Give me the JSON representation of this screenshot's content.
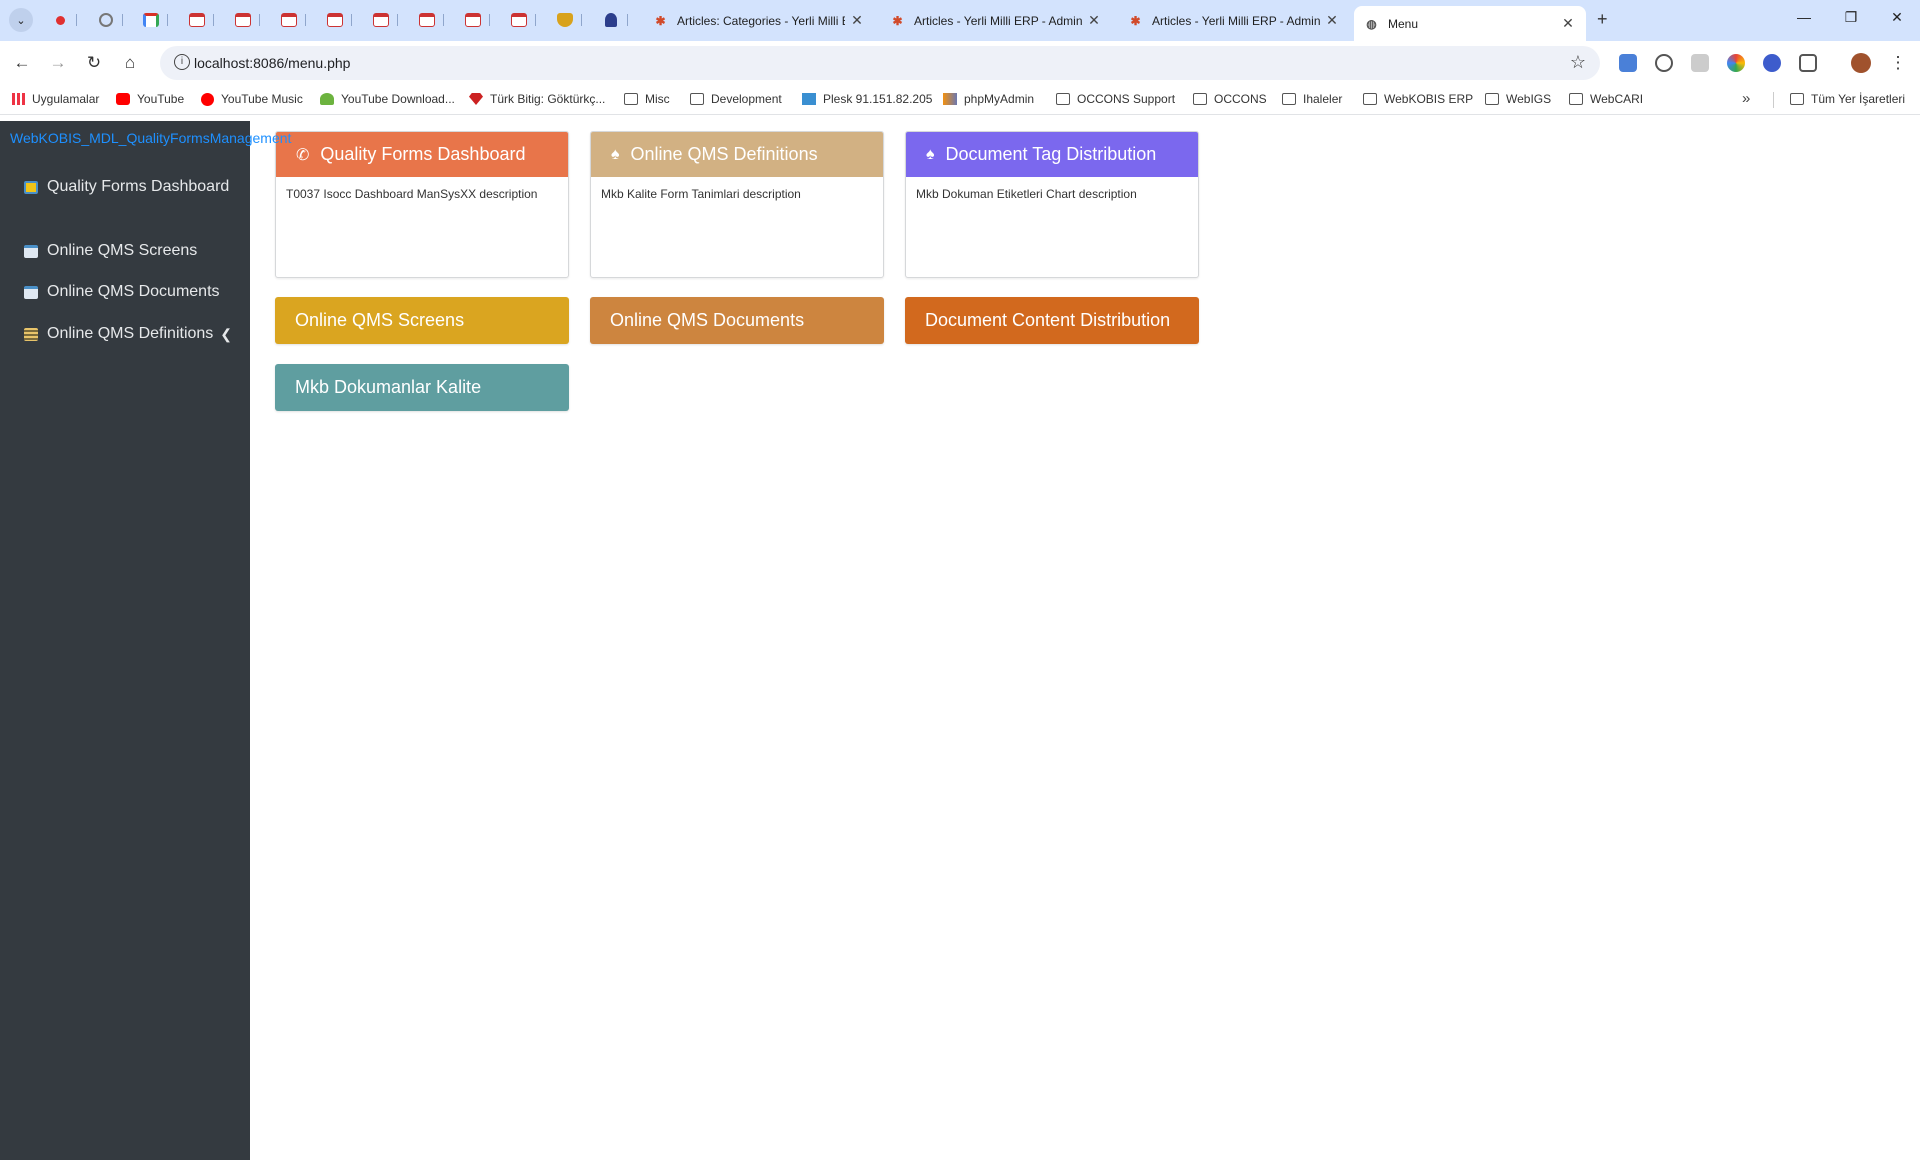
{
  "browser": {
    "tabs": [
      {
        "title": "Articles: Categories - Yerli Milli ERP - Administration"
      },
      {
        "title": "Articles - Yerli Milli ERP - Administration"
      },
      {
        "title": "Articles - Yerli Milli ERP - Administration"
      },
      {
        "title": "Menu",
        "active": true
      }
    ],
    "url": "localhost:8086/menu.php",
    "bookmarks": [
      "Uygulamalar",
      "YouTube",
      "YouTube Music",
      "YouTube Download...",
      "Türk Bitig: Göktürkç...",
      "Misc",
      "Development",
      "Plesk 91.151.82.205",
      "phpMyAdmin",
      "OCCONS Support",
      "OCCONS",
      "Ihaleler",
      "WebKOBIS ERP",
      "WebIGS",
      "WebCARI"
    ],
    "bookmarks_all": "Tüm Yer İşaretleri"
  },
  "sidebar": {
    "brand": "WebKOBIS_MDL_QualityFormsManagement",
    "items": [
      {
        "label": "Quality Forms Dashboard",
        "icon": "table-icon"
      },
      {
        "label": "Online QMS Screens",
        "icon": "calendar-icon"
      },
      {
        "label": "Online QMS Documents",
        "icon": "calendar-icon"
      },
      {
        "label": "Online QMS Definitions",
        "icon": "list-icon",
        "expandable": true
      }
    ]
  },
  "cards": [
    {
      "title": "Quality Forms Dashboard",
      "description": "T0037 Isocc Dashboard ManSysXX description",
      "color": "#e8754a",
      "icon": "phone-icon"
    },
    {
      "title": "Online QMS Definitions",
      "description": "Mkb Kalite Form Tanimlari description",
      "color": "#d2b183",
      "icon": "tree-icon"
    },
    {
      "title": "Document Tag Distribution",
      "description": "Mkb Dokuman Etiketleri Chart description",
      "color": "#7b68ee",
      "icon": "tree-icon"
    }
  ],
  "buttons": [
    {
      "title": "Online QMS Screens",
      "color": "#daa520"
    },
    {
      "title": "Online QMS Documents",
      "color": "#cd853f"
    },
    {
      "title": "Document Content Distribution",
      "color": "#d2691e"
    },
    {
      "title": "Mkb Dokumanlar Kalite",
      "color": "#5f9ea0"
    }
  ]
}
